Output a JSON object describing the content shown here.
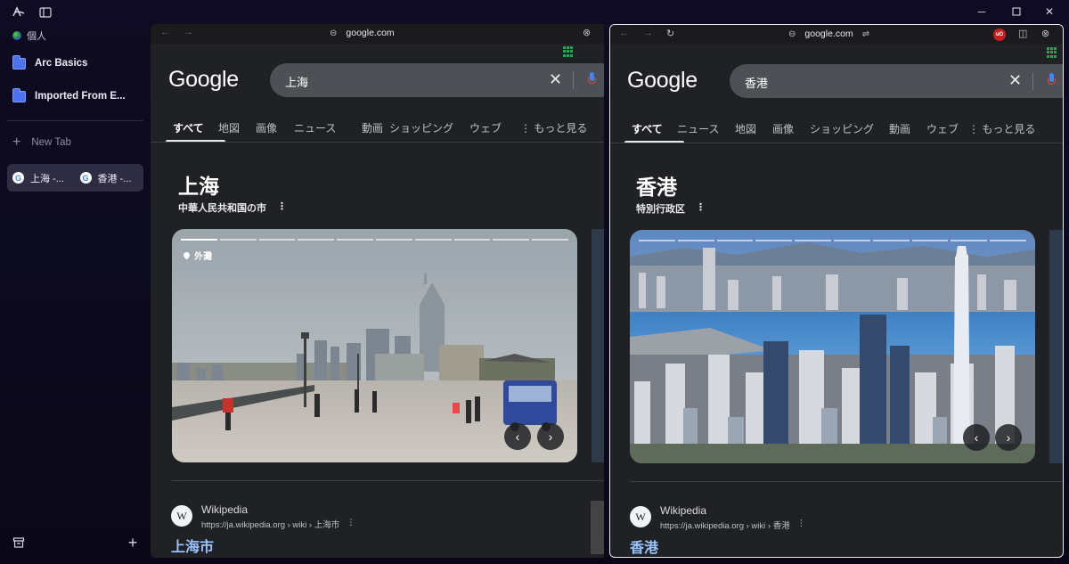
{
  "sidebar": {
    "profile": "個人",
    "spaces": [
      "Arc Basics",
      "Imported From E..."
    ],
    "new_tab": "New Tab",
    "split_tab": {
      "left": "上海 -...",
      "right": "香港 -..."
    }
  },
  "left_pane": {
    "url": "google.com",
    "logo": "Google",
    "query": "上海",
    "tabs": [
      "すべて",
      "地図",
      "画像",
      "ニュース",
      "動画",
      "ショッピング",
      "ウェブ",
      "もっと見る"
    ],
    "title": "上海",
    "subtitle": "中華人民共和国の市",
    "photo_location": "外灘",
    "result": {
      "site": "Wikipedia",
      "url": "https://ja.wikipedia.org › wiki › 上海市",
      "title": "上海市"
    }
  },
  "right_pane": {
    "url": "google.com",
    "logo": "Google",
    "query": "香港",
    "tabs": [
      "すべて",
      "ニュース",
      "地図",
      "画像",
      "ショッピング",
      "動画",
      "ウェブ",
      "もっと見る"
    ],
    "title": "香港",
    "subtitle": "特別行政区",
    "extension_badge": "uO",
    "result": {
      "site": "Wikipedia",
      "url": "https://ja.wikipedia.org › wiki › 香港",
      "title": "香港"
    }
  },
  "colors": {
    "accent_folder": "#4c72f0",
    "link": "#99c3ff",
    "badge": "#c81e1e"
  }
}
